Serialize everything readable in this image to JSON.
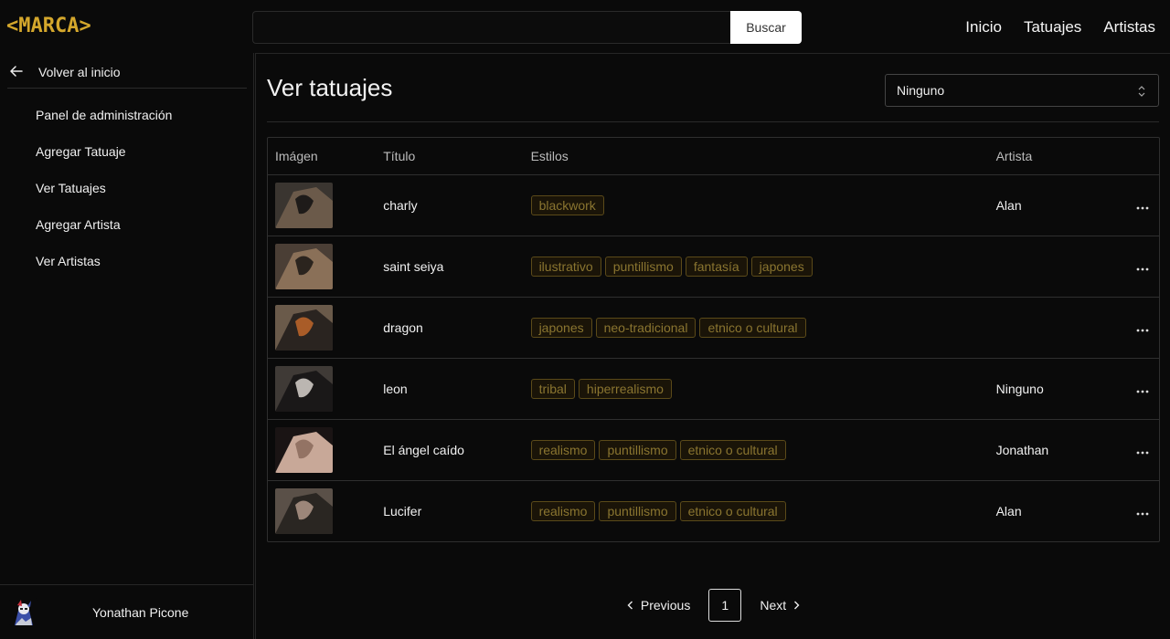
{
  "brand": "<MARCA>",
  "search": {
    "placeholder": "",
    "button_label": "Buscar"
  },
  "topnav": [
    "Inicio",
    "Tatuajes",
    "Artistas"
  ],
  "sidebar": {
    "back_label": "Volver al inicio",
    "items": [
      {
        "label": "Panel de administración"
      },
      {
        "label": "Agregar Tatuaje"
      },
      {
        "label": "Ver Tatuajes"
      },
      {
        "label": "Agregar Artista"
      },
      {
        "label": "Ver Artistas"
      }
    ],
    "user": {
      "name": "Yonathan Picone"
    }
  },
  "main": {
    "title": "Ver tatuajes",
    "filter": {
      "value": "Ninguno"
    },
    "table": {
      "headers": [
        "Imágen",
        "Título",
        "Estilos",
        "Artista"
      ],
      "rows": [
        {
          "title": "charly",
          "styles": [
            "blackwork"
          ],
          "artist": "Alan"
        },
        {
          "title": "saint seiya",
          "styles": [
            "ilustrativo",
            "puntillismo",
            "fantasía",
            "japones"
          ],
          "artist": ""
        },
        {
          "title": "dragon",
          "styles": [
            "japones",
            "neo-tradicional",
            "etnico o cultural"
          ],
          "artist": ""
        },
        {
          "title": "leon",
          "styles": [
            "tribal",
            "hiperrealismo"
          ],
          "artist": "Ninguno"
        },
        {
          "title": "El ángel caído",
          "styles": [
            "realismo",
            "puntillismo",
            "etnico o cultural"
          ],
          "artist": "Jonathan"
        },
        {
          "title": "Lucifer",
          "styles": [
            "realismo",
            "puntillismo",
            "etnico o cultural"
          ],
          "artist": "Alan"
        }
      ]
    }
  },
  "pagination": {
    "previous": "Previous",
    "page": "1",
    "next": "Next"
  },
  "colors": {
    "accent": "#d4a72c",
    "background": "#0a0a0a",
    "tag_border": "#5b4a19",
    "tag_text": "#8a7530"
  }
}
